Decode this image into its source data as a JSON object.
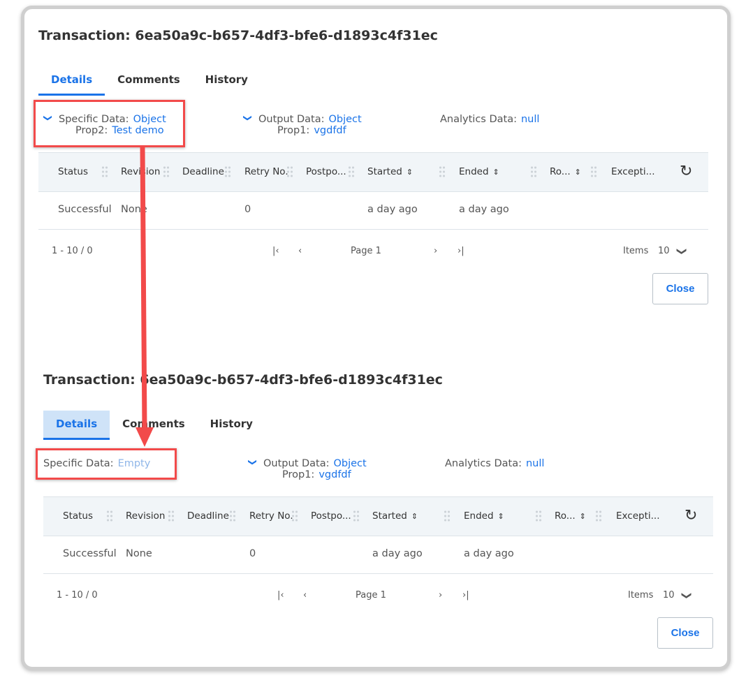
{
  "panels": [
    {
      "title": "Transaction: 6ea50a9c-b657-4df3-bfe6-d1893c4f31ec",
      "tabs": [
        "Details",
        "Comments",
        "History"
      ],
      "specific": {
        "label": "Specific Data:",
        "value": "Object",
        "prop_label": "Prop2:",
        "prop_value": "Test demo"
      },
      "output": {
        "label": "Output Data:",
        "value": "Object",
        "prop_label": "Prop1:",
        "prop_value": "vgdfdf"
      },
      "analytics": {
        "label": "Analytics Data:",
        "value": "null"
      },
      "columns": [
        "Status",
        "Revision",
        "Deadline",
        "Retry No.",
        "Postpo...",
        "Started",
        "Ended",
        "Ro...",
        "Excepti..."
      ],
      "row": [
        "Successful",
        "None",
        "",
        "0",
        "",
        "a day ago",
        "a day ago",
        "",
        ""
      ],
      "pager": {
        "range": "1 - 10 / 0",
        "page": "Page 1",
        "items_label": "Items",
        "items_value": "10"
      },
      "close": "Close"
    },
    {
      "title": "Transaction: 6ea50a9c-b657-4df3-bfe6-d1893c4f31ec",
      "tabs": [
        "Details",
        "Comments",
        "History"
      ],
      "specific": {
        "label": "Specific Data:",
        "value": "Empty"
      },
      "output": {
        "label": "Output Data:",
        "value": "Object",
        "prop_label": "Prop1:",
        "prop_value": "vgdfdf"
      },
      "analytics": {
        "label": "Analytics Data:",
        "value": "null"
      },
      "columns": [
        "Status",
        "Revision",
        "Deadline",
        "Retry No.",
        "Postpo...",
        "Started",
        "Ended",
        "Ro...",
        "Excepti..."
      ],
      "row": [
        "Successful",
        "None",
        "",
        "0",
        "",
        "a day ago",
        "a day ago",
        "",
        ""
      ],
      "pager": {
        "range": "1 - 10 / 0",
        "page": "Page 1",
        "items_label": "Items",
        "items_value": "10"
      },
      "close": "Close"
    }
  ],
  "colors": {
    "accent": "#1a73e8",
    "annotation": "#f24a4a",
    "header_bg": "#f1f5f8"
  }
}
